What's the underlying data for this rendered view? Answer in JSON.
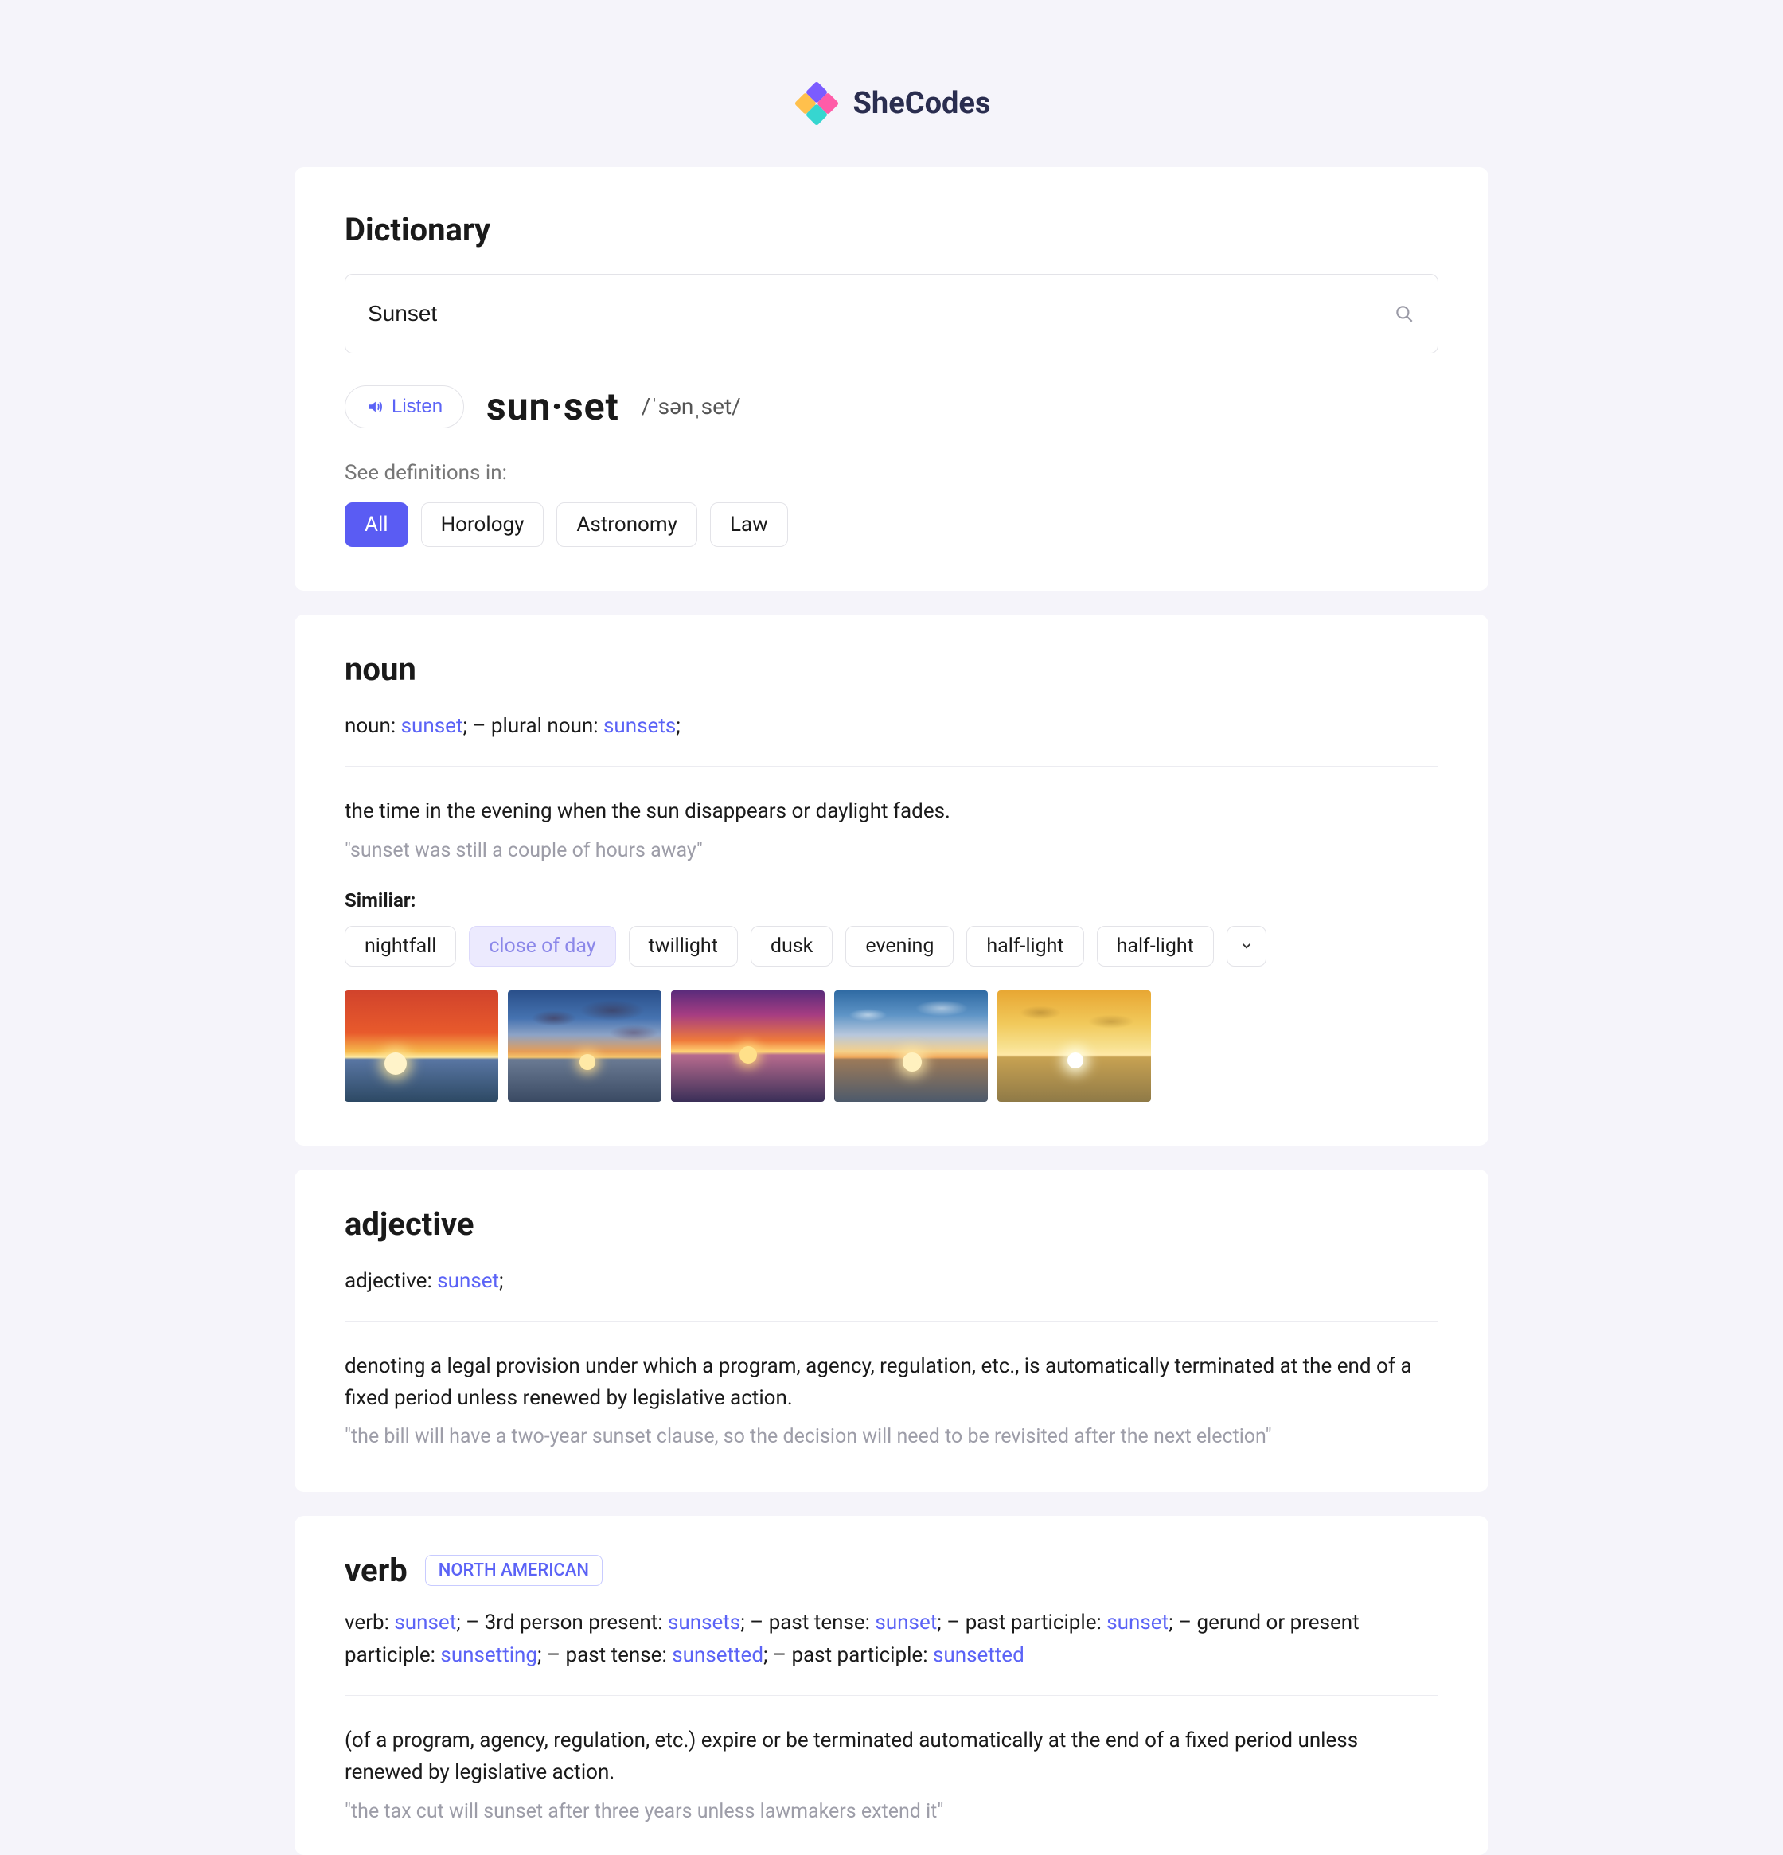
{
  "brand": "SheCodes",
  "header": {
    "title": "Dictionary",
    "search_value": "Sunset",
    "listen_label": "Listen",
    "word": "sun·set",
    "pronunciation": "/ˈsənˌset/",
    "see_label": "See definitions in:",
    "categories": [
      "All",
      "Horology",
      "Astronomy",
      "Law"
    ]
  },
  "noun": {
    "pos": "noun",
    "forms_prefix_1": "noun: ",
    "forms_word_1": "sunset",
    "forms_sep": ";   –   plural noun: ",
    "forms_word_2": "sunsets",
    "forms_end": ";",
    "definition": "the time in the evening when the sun disappears or daylight fades.",
    "example": "\"sunset was still a couple of hours away\"",
    "similar_label": "Similiar:",
    "similar": [
      "nightfall",
      "close of day",
      "twillight",
      "dusk",
      "evening",
      "half-light",
      "half-light"
    ]
  },
  "adjective": {
    "pos": "adjective",
    "forms_prefix": "adjective: ",
    "forms_word": "sunset",
    "forms_end": ";",
    "definition": "denoting a legal provision under which a program, agency, regulation, etc., is automatically terminated at the end of a fixed period unless renewed by legislative action.",
    "example": "\"the bill will have a two-year sunset clause, so the decision will need to be revisited after the next election\""
  },
  "verb": {
    "pos": "verb",
    "badge": "NORTH AMERICAN",
    "forms_html": "verb: <span class='blue'>sunset</span>;   –   3rd person present: <span class='blue'>sunsets</span>;   –   past tense: <span class='blue'>sunset</span>;   –   past participle: <span class='blue'>sunset</span>;   –   gerund or present participle: <span class='blue'>sunsetting</span>;   –   past tense: <span class='blue'>sunsetted</span>;   –   past participle: <span class='blue'>sunsetted</span>",
    "definition": "(of a program, agency, regulation, etc.) expire or be terminated automatically at the end of a fixed period unless renewed by legislative action.",
    "example": "\"the tax cut will sunset after three years unless lawmakers extend it\""
  }
}
